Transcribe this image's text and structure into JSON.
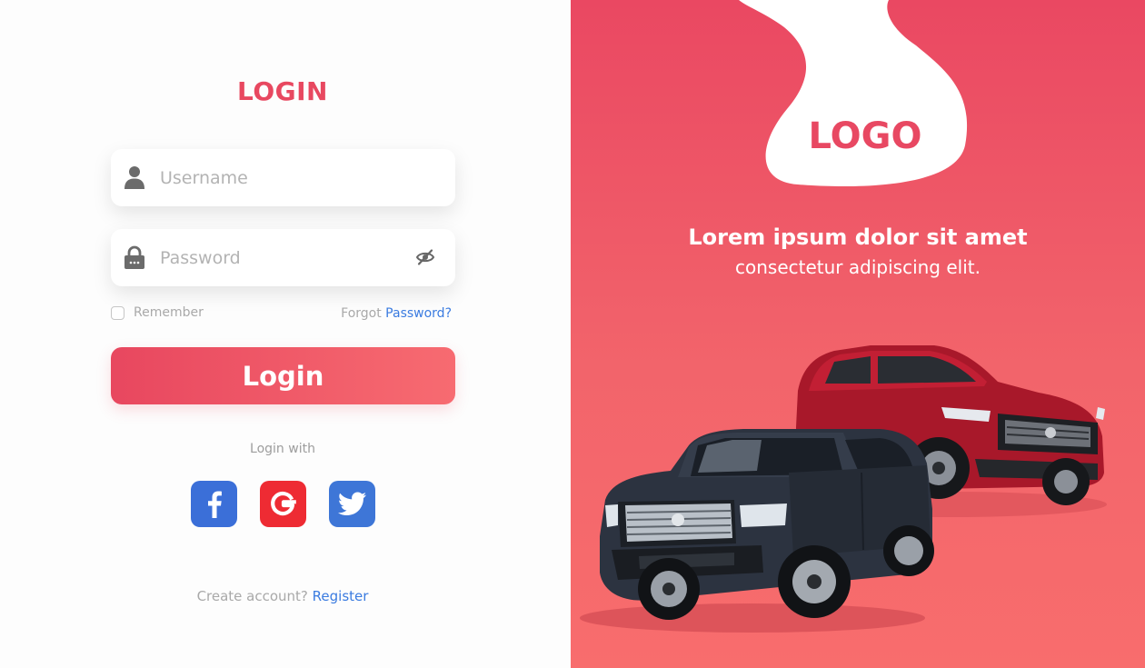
{
  "login_form": {
    "title": "LOGIN",
    "username_placeholder": "Username",
    "password_placeholder": "Password",
    "remember_label": "Remember",
    "forgot_prefix": "Forgot ",
    "forgot_link": "Password?",
    "login_button": "Login",
    "login_with_label": "Login with",
    "social": [
      {
        "name": "facebook",
        "icon": "facebook-icon",
        "color": "#3b6fd8"
      },
      {
        "name": "google",
        "icon": "google-icon",
        "color": "#ee2b33"
      },
      {
        "name": "twitter",
        "icon": "twitter-icon",
        "color": "#3e76d7"
      }
    ],
    "create_prefix": "Create account? ",
    "register_link": "Register"
  },
  "hero": {
    "logo": "LOGO",
    "headline": "Lorem ipsum dolor sit amet",
    "subline": "consectetur adipiscing elit."
  },
  "colors": {
    "accent": "#e84860",
    "link": "#3a7be0",
    "panel_gradient_top": "#ea4862",
    "panel_gradient_bottom": "#f86d6d"
  }
}
